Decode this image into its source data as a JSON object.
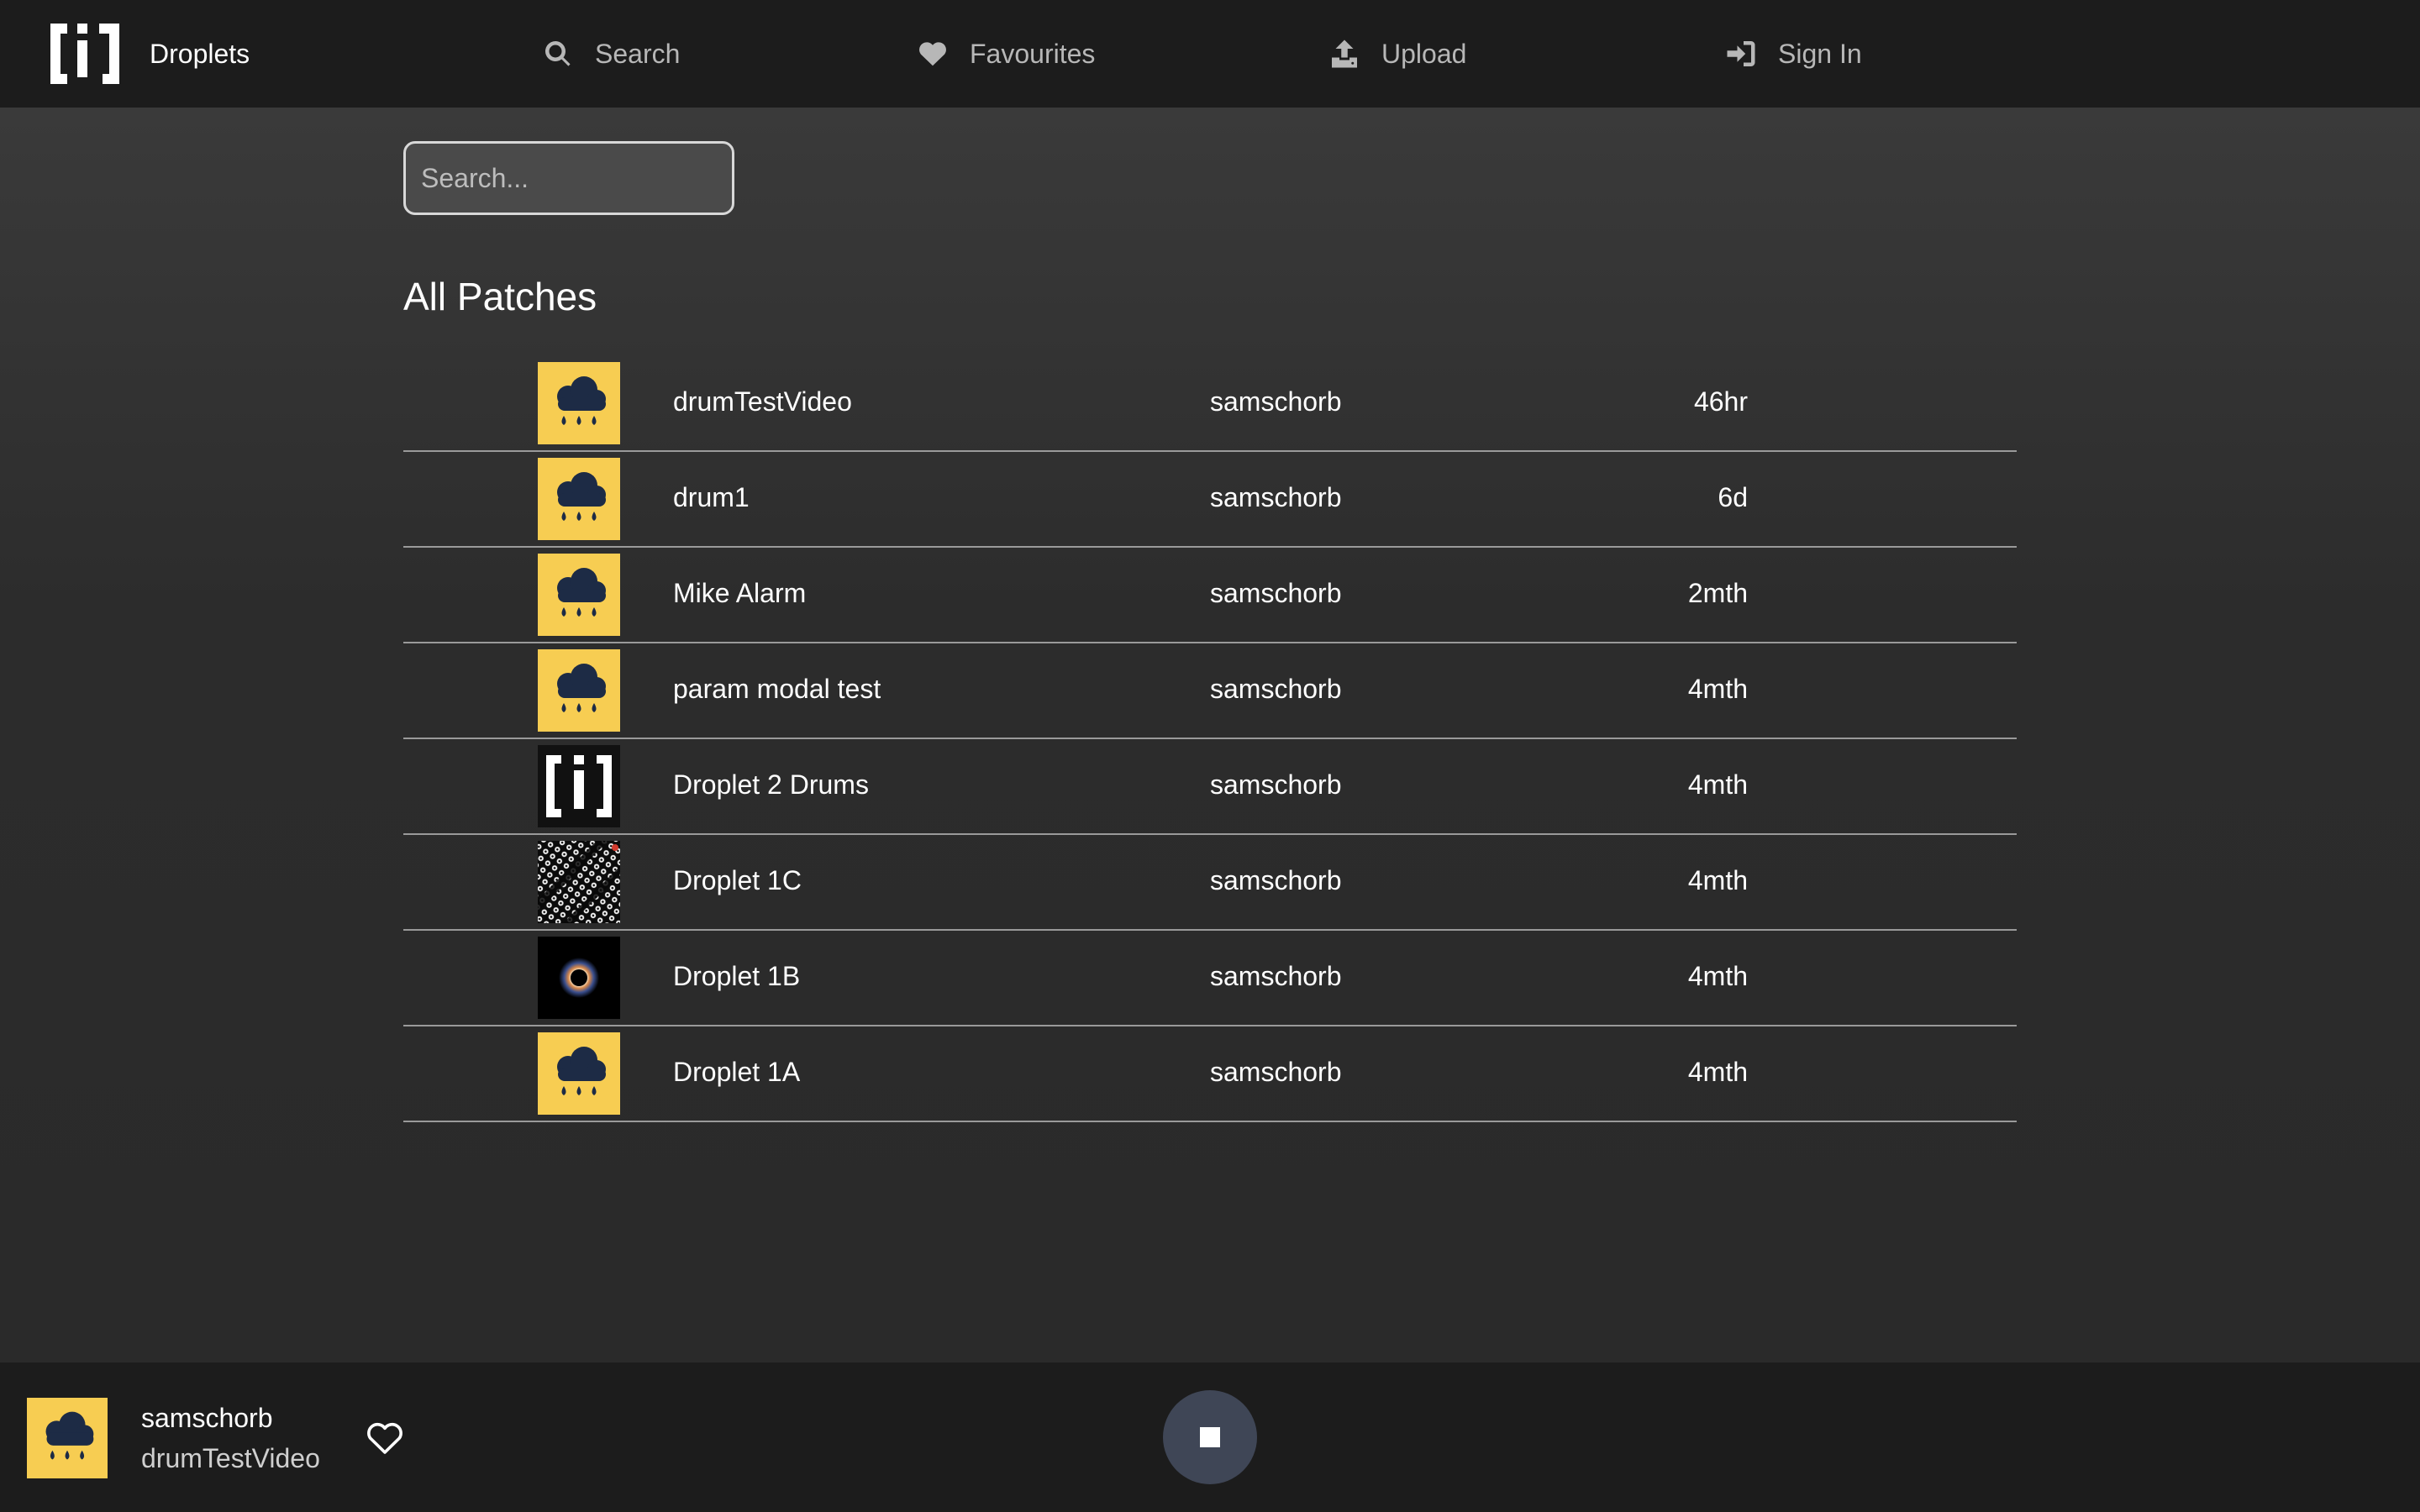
{
  "nav": {
    "brand": "Droplets",
    "search": "Search",
    "favourites": "Favourites",
    "upload": "Upload",
    "sign_in": "Sign In",
    "icons": [
      "search-icon",
      "heart-icon",
      "upload-icon",
      "sign-in-icon"
    ]
  },
  "search": {
    "placeholder": "Search..."
  },
  "section_title": "All Patches",
  "patches": [
    {
      "name": "drumTestVideo",
      "user": "samschorb",
      "age": "46hr",
      "thumb": "rain-cloud"
    },
    {
      "name": "drum1",
      "user": "samschorb",
      "age": "6d",
      "thumb": "rain-cloud"
    },
    {
      "name": "Mike Alarm",
      "user": "samschorb",
      "age": "2mth",
      "thumb": "rain-cloud"
    },
    {
      "name": "param modal test",
      "user": "samschorb",
      "age": "4mth",
      "thumb": "rain-cloud"
    },
    {
      "name": "Droplet 2 Drums",
      "user": "samschorb",
      "age": "4mth",
      "thumb": "droplets-logo"
    },
    {
      "name": "Droplet 1C",
      "user": "samschorb",
      "age": "4mth",
      "thumb": "dotted-pattern"
    },
    {
      "name": "Droplet 1B",
      "user": "samschorb",
      "age": "4mth",
      "thumb": "eclipse"
    },
    {
      "name": "Droplet 1A",
      "user": "samschorb",
      "age": "4mth",
      "thumb": "rain-cloud"
    }
  ],
  "player": {
    "user": "samschorb",
    "patch": "drumTestVideo",
    "playing": true
  },
  "colors": {
    "accent_yellow": "#f7cd52",
    "cloud_navy": "#1d2b45",
    "nav_bg": "#1c1c1c",
    "stop_button": "#3f4656"
  }
}
